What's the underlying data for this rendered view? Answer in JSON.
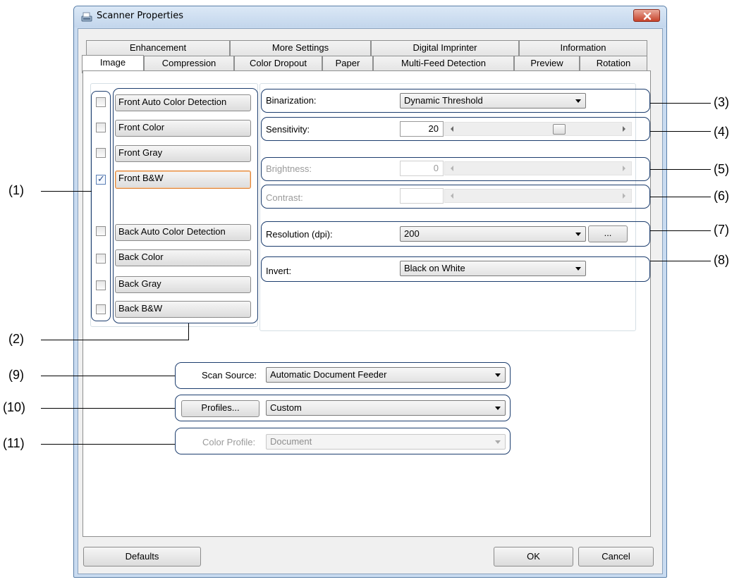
{
  "window": {
    "title": "Scanner Properties"
  },
  "tabs": {
    "row1": [
      "Enhancement",
      "More Settings",
      "Digital Imprinter",
      "Information"
    ],
    "row2": [
      "Image",
      "Compression",
      "Color Dropout",
      "Paper",
      "Multi-Feed Detection",
      "Preview",
      "Rotation"
    ],
    "active": "Image"
  },
  "image_types": [
    {
      "label": "Front Auto Color Detection",
      "checked": false
    },
    {
      "label": "Front Color",
      "checked": false
    },
    {
      "label": "Front Gray",
      "checked": false
    },
    {
      "label": "Front B&W",
      "checked": true
    },
    {
      "label": "Back Auto Color Detection",
      "checked": false
    },
    {
      "label": "Back Color",
      "checked": false
    },
    {
      "label": "Back Gray",
      "checked": false
    },
    {
      "label": "Back B&W",
      "checked": false
    }
  ],
  "settings": {
    "binarization": {
      "label": "Binarization:",
      "value": "Dynamic Threshold"
    },
    "sensitivity": {
      "label": "Sensitivity:",
      "value": "20",
      "slider_fraction": 0.64
    },
    "brightness": {
      "label": "Brightness:",
      "value": "0",
      "enabled": false
    },
    "contrast": {
      "label": "Contrast:",
      "value": "",
      "enabled": false
    },
    "resolution": {
      "label": "Resolution (dpi):",
      "value": "200",
      "more_button": "..."
    },
    "invert": {
      "label": "Invert:",
      "value": "Black on White"
    }
  },
  "scan_source": {
    "label": "Scan Source:",
    "value": "Automatic Document Feeder"
  },
  "profiles": {
    "button": "Profiles...",
    "value": "Custom"
  },
  "color_profile": {
    "label": "Color Profile:",
    "value": "Document",
    "enabled": false
  },
  "footer": {
    "defaults": "Defaults",
    "ok": "OK",
    "cancel": "Cancel"
  },
  "annotations": [
    "(1)",
    "(2)",
    "(3)",
    "(4)",
    "(5)",
    "(6)",
    "(7)",
    "(8)",
    "(9)",
    "(10)",
    "(11)"
  ],
  "colors": {
    "callout": "#1c3d6e",
    "focus_border": "#e0873d",
    "close_button": "#c7432b"
  }
}
